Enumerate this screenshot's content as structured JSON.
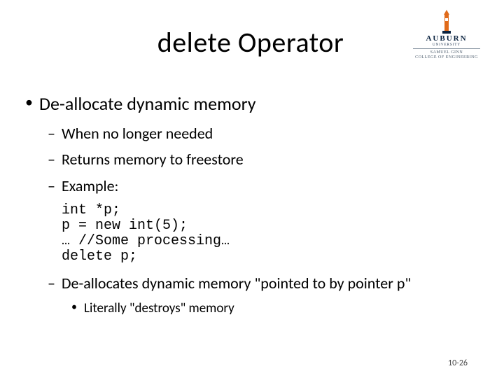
{
  "title": "delete Operator",
  "logo": {
    "wordmark": "AUBURN",
    "university": "UNIVERSITY",
    "college_line1": "SAMUEL GINN",
    "college_line2": "COLLEGE OF ENGINEERING"
  },
  "bullets": {
    "l1_1": "De-allocate dynamic memory",
    "l2_1": "When no longer needed",
    "l2_2": "Returns memory to freestore",
    "l2_3": "Example:",
    "code": "int *p;\np = new int(5);\n… //Some processing…\ndelete p;",
    "l2_4": "De-allocates dynamic memory \"pointed to by pointer p\"",
    "l3_1": "Literally \"destroys\" memory"
  },
  "footer": "10-26"
}
